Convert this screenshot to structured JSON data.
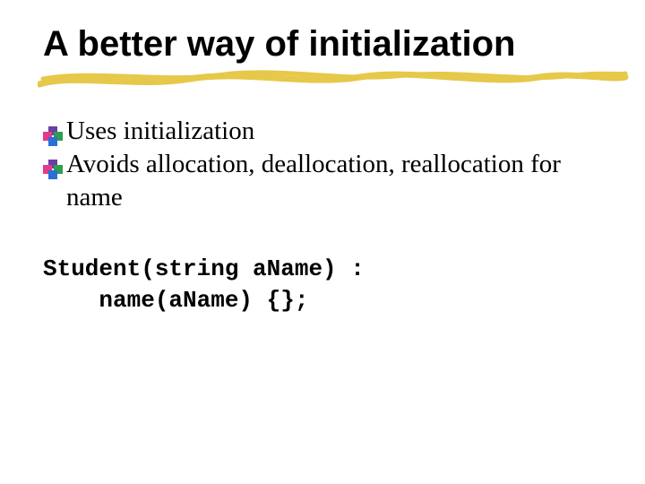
{
  "title": "A better way of initialization",
  "bullets": [
    {
      "text": "Uses initialization"
    },
    {
      "text": "Avoids allocation, deallocation, reallocation for name"
    }
  ],
  "code": "Student(string aName) :\n    name(aName) {};"
}
